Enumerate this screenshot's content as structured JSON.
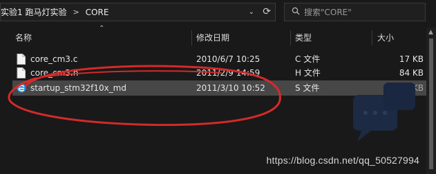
{
  "address_bar": {
    "segments": [
      "实验1 跑马灯实验",
      "CORE"
    ],
    "separator": ">"
  },
  "search": {
    "placeholder": "搜索\"CORE\""
  },
  "columns": {
    "name": "名称",
    "date": "修改日期",
    "type": "类型",
    "size": "大小"
  },
  "files": [
    {
      "name": "core_cm3.c",
      "date": "2010/6/7 10:25",
      "type": "C 文件",
      "size": "17 KB",
      "icon": "c-file-icon"
    },
    {
      "name": "core_cm3.h",
      "date": "2011/2/9 14:59",
      "type": "H 文件",
      "size": "84 KB",
      "icon": "h-file-icon"
    },
    {
      "name": "startup_stm32f10x_md",
      "date": "2011/3/10 10:52",
      "type": "S 文件",
      "size": "13 KB",
      "icon": "edge-browser-icon",
      "selected": true
    }
  ],
  "watermark": "https://blog.csdn.net/qq_50527994",
  "colors": {
    "annotation": "#d42a2a",
    "selection": "#474747",
    "background": "#191919"
  }
}
